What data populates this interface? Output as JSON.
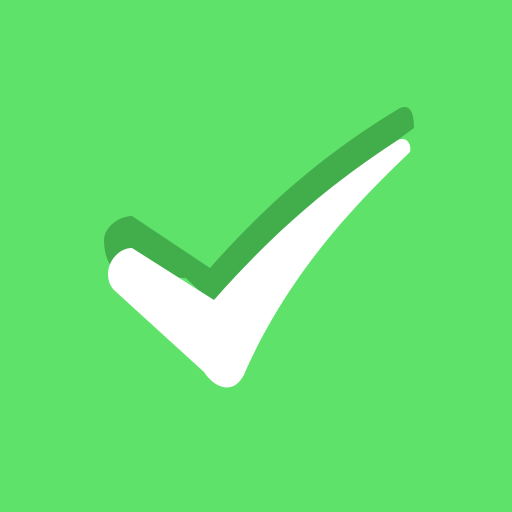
{
  "icon": {
    "name": "checkmark-icon",
    "colors": {
      "background": "#5FE26A",
      "check_shadow": "#42AE4B",
      "check_face": "#FFFFFF"
    }
  }
}
